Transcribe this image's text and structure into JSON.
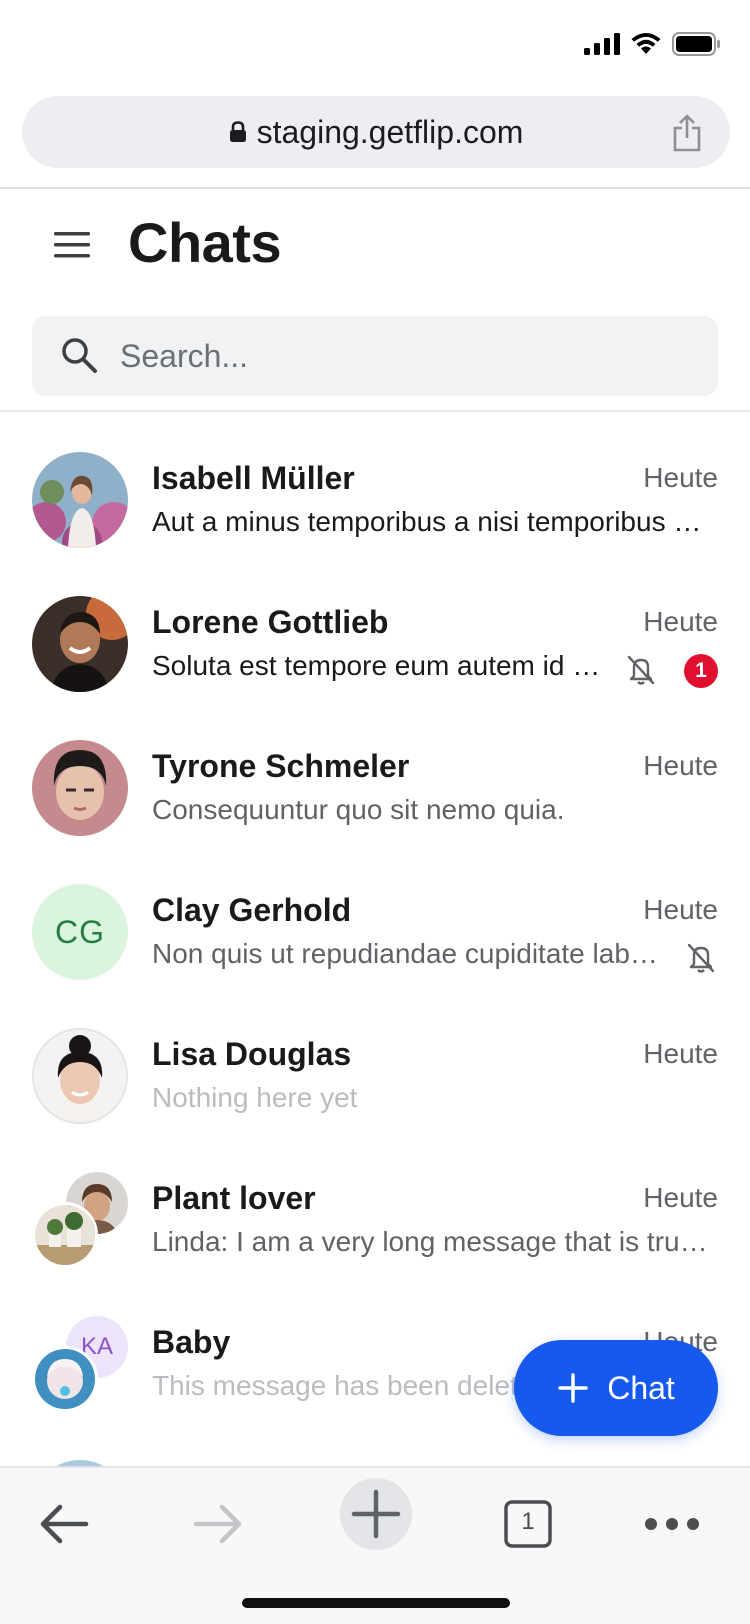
{
  "browser": {
    "url": "staging.getflip.com"
  },
  "header": {
    "title": "Chats"
  },
  "search": {
    "placeholder": "Search..."
  },
  "chats": [
    {
      "name": "Isabell Müller",
      "time": "Heute",
      "preview": "Aut a minus temporibus a nisi temporibus dolor",
      "muted": false,
      "unread": null
    },
    {
      "name": "Lorene Gottlieb",
      "time": "Heute",
      "preview": "Soluta est tempore eum autem id dolorum",
      "muted": true,
      "unread": "1"
    },
    {
      "name": "Tyrone Schmeler",
      "time": "Heute",
      "preview": "Consequuntur quo sit nemo quia.",
      "muted": false,
      "unread": null
    },
    {
      "name": "Clay Gerhold",
      "time": "Heute",
      "preview": "Non quis ut repudiandae cupiditate laborum",
      "muted": true,
      "unread": null,
      "initials": "CG"
    },
    {
      "name": "Lisa Douglas",
      "time": "Heute",
      "preview": "Nothing here yet",
      "muted": false,
      "unread": null
    },
    {
      "name": "Plant lover",
      "time": "Heute",
      "preview": "Linda: I am a very long message that is truncated",
      "muted": false,
      "unread": null
    },
    {
      "name": "Baby",
      "time": "Heute",
      "preview": "This message has been deleted",
      "muted": false,
      "unread": null,
      "initials": "KA"
    }
  ],
  "fab": {
    "label": "Chat"
  },
  "toolbar": {
    "tab_count": "1"
  },
  "colors": {
    "accent": "#1559ed",
    "badge": "#e0102f",
    "initials_green_bg": "#dbf4df",
    "initials_green_fg": "#24803f",
    "initials_purple_bg": "#ede4fb",
    "initials_purple_fg": "#8a55c9"
  },
  "icons": [
    "signal-icon",
    "wifi-icon",
    "battery-icon",
    "lock-icon",
    "share-icon",
    "menu-icon",
    "search-icon",
    "bell-off-icon",
    "plus-icon",
    "back-arrow-icon",
    "forward-arrow-icon",
    "tabs-icon",
    "more-icon"
  ]
}
